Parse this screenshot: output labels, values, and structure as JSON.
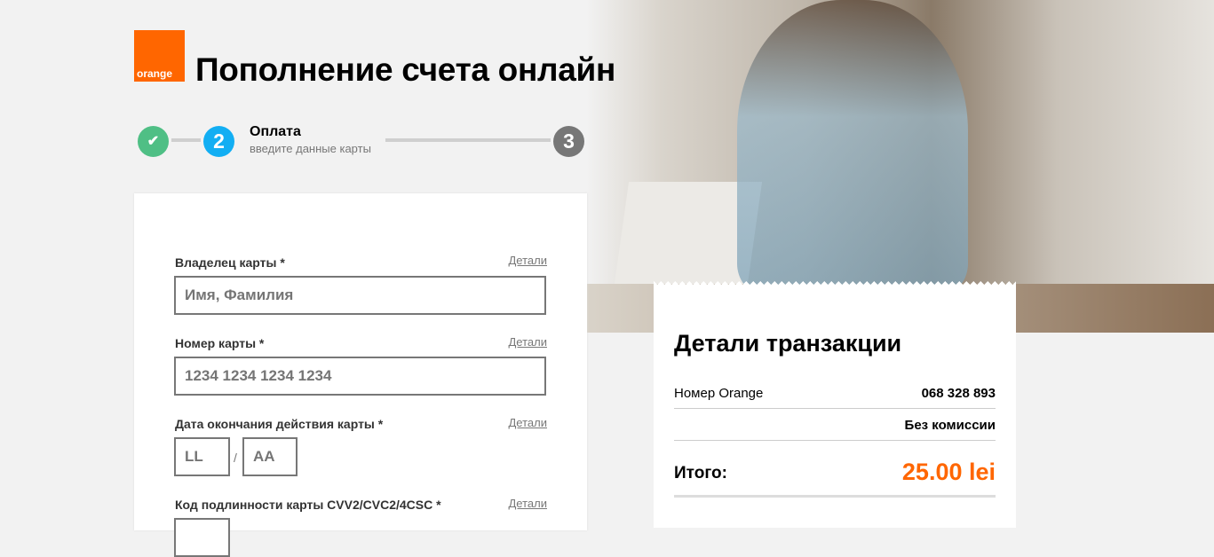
{
  "brand": {
    "logo_text": "orange",
    "color": "#ff6600"
  },
  "header": {
    "title": "Пополнение счета онлайн"
  },
  "stepper": {
    "step1_icon": "check-icon",
    "step2_number": "2",
    "step2_title": "Оплата",
    "step2_subtitle": "введите данные карты",
    "step3_number": "3"
  },
  "form": {
    "details_link": "Детали",
    "cardholder": {
      "label": "Владелец карты *",
      "placeholder": "Имя, Фамилия"
    },
    "card_number": {
      "label": "Номер карты *",
      "placeholder": "1234 1234 1234 1234"
    },
    "expiry": {
      "label": "Дата окончания действия карты *",
      "month_placeholder": "LL",
      "separator": "/",
      "year_placeholder": "AA"
    },
    "cvv": {
      "label": "Код подлинности карты CVV2/CVC2/4CSC *"
    }
  },
  "transaction": {
    "title": "Детали транзакции",
    "number_label": "Номер Orange",
    "number_value": "068 328 893",
    "commission": "Без комиссии",
    "total_label": "Итого:",
    "total_value": "25.00 lei"
  }
}
